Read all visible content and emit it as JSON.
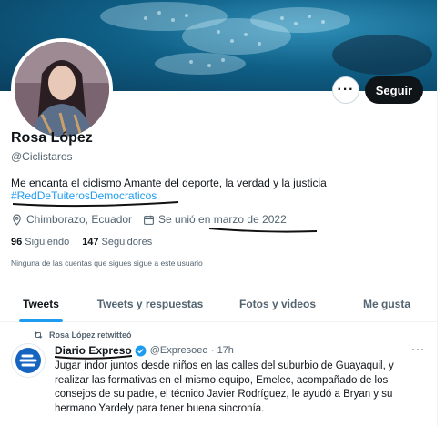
{
  "profile": {
    "follow_label": "Seguir",
    "more_label": "···",
    "name": "Rosa López",
    "handle": "@Ciclistaros",
    "bio": "Me encanta el ciclismo Amante del deporte, la verdad y la justicia",
    "hashtag": "#RedDeTuiterosDemocraticos",
    "location": "Chimborazo, Ecuador",
    "joined": "Se unió en marzo de 2022",
    "following_count": "96",
    "following_label": "Siguiendo",
    "followers_count": "147",
    "followers_label": "Seguidores",
    "no_common": "Ninguna de las cuentas que sigues sigue a este usuario"
  },
  "tabs": [
    {
      "label": "Tweets",
      "active": true
    },
    {
      "label": "Tweets y respuestas",
      "active": false
    },
    {
      "label": "Fotos y videos",
      "active": false
    },
    {
      "label": "Me gusta",
      "active": false
    }
  ],
  "tweet": {
    "retweet_label": "Rosa López retwitteó",
    "author_name": "Diario Expreso",
    "author_handle": "@Expresoec",
    "time": "· 17h",
    "more_label": "···",
    "text": "Jugar índor juntos desde niños en las calles del suburbio de Guayaquil, y realizar las formativas en el mismo equipo, Emelec, acompañado de los consejos de su padre, el técnico Javier Rodríguez, le ayudó a Bryan y su hermano Yardely para tener buena sincronía."
  },
  "colors": {
    "accent": "#1d9bf0",
    "text": "#0f1419",
    "muted": "#536471",
    "button_dark": "#0f1419",
    "verified": "#1d9bf0",
    "expreso_blue": "#1565c0"
  }
}
